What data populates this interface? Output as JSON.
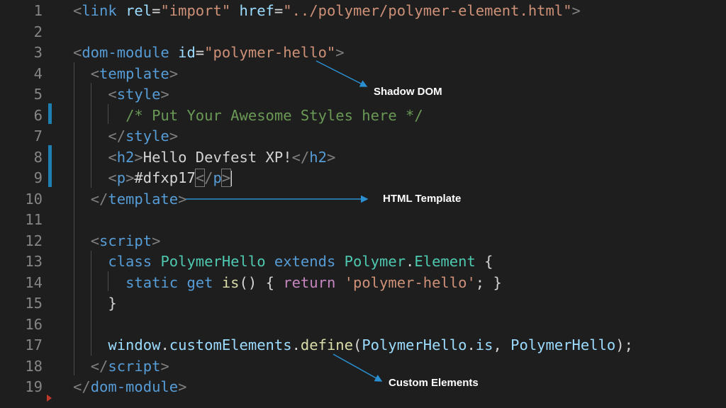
{
  "editor": {
    "line_numbers": [
      "1",
      "2",
      "3",
      "4",
      "5",
      "6",
      "7",
      "8",
      "9",
      "10",
      "11",
      "12",
      "13",
      "14",
      "15",
      "16",
      "17",
      "18",
      "19"
    ],
    "lines": [
      [
        [
          "t-punc",
          "<"
        ],
        [
          "t-tag",
          "link"
        ],
        [
          "t-plain",
          " "
        ],
        [
          "t-attr",
          "rel"
        ],
        [
          "t-plain",
          "="
        ],
        [
          "t-str",
          "\"import\""
        ],
        [
          "t-plain",
          " "
        ],
        [
          "t-attr",
          "href"
        ],
        [
          "t-plain",
          "="
        ],
        [
          "t-str",
          "\"../polymer/polymer-element.html\""
        ],
        [
          "t-punc",
          ">"
        ]
      ],
      [],
      [
        [
          "t-punc",
          "<"
        ],
        [
          "t-tag",
          "dom-module"
        ],
        [
          "t-plain",
          " "
        ],
        [
          "t-attr",
          "id"
        ],
        [
          "t-plain",
          "="
        ],
        [
          "t-str",
          "\"polymer-hello\""
        ],
        [
          "t-punc",
          ">"
        ]
      ],
      [
        [
          "t-plain",
          "  "
        ],
        [
          "t-punc",
          "<"
        ],
        [
          "t-tag",
          "template"
        ],
        [
          "t-punc",
          ">"
        ]
      ],
      [
        [
          "t-plain",
          "    "
        ],
        [
          "t-punc",
          "<"
        ],
        [
          "t-tag",
          "style"
        ],
        [
          "t-punc",
          ">"
        ]
      ],
      [
        [
          "t-plain",
          "      "
        ],
        [
          "t-comment",
          "/* Put Your Awesome Styles here */"
        ]
      ],
      [
        [
          "t-plain",
          "    "
        ],
        [
          "t-punc",
          "</"
        ],
        [
          "t-tag",
          "style"
        ],
        [
          "t-punc",
          ">"
        ]
      ],
      [
        [
          "t-plain",
          "    "
        ],
        [
          "t-punc",
          "<"
        ],
        [
          "t-tag",
          "h2"
        ],
        [
          "t-punc",
          ">"
        ],
        [
          "t-plain",
          "Hello Devfest XP!"
        ],
        [
          "t-punc",
          "</"
        ],
        [
          "t-tag",
          "h2"
        ],
        [
          "t-punc",
          ">"
        ]
      ],
      [
        [
          "t-plain",
          "    "
        ],
        [
          "t-punc",
          "<"
        ],
        [
          "t-tag",
          "p"
        ],
        [
          "t-punc",
          ">"
        ],
        [
          "t-plain",
          "#dfxp17"
        ],
        [
          "t-hl t-punc",
          "<"
        ],
        [
          "t-punc",
          "/"
        ],
        [
          "t-tag",
          "p"
        ],
        [
          "t-hl t-punc",
          ">"
        ],
        [
          "t-cursor",
          ""
        ]
      ],
      [
        [
          "t-plain",
          "  "
        ],
        [
          "t-punc",
          "</"
        ],
        [
          "t-tag",
          "template"
        ],
        [
          "t-punc",
          ">"
        ]
      ],
      [],
      [
        [
          "t-plain",
          "  "
        ],
        [
          "t-punc",
          "<"
        ],
        [
          "t-tag",
          "script"
        ],
        [
          "t-punc",
          ">"
        ]
      ],
      [
        [
          "t-plain",
          "    "
        ],
        [
          "t-kw",
          "class"
        ],
        [
          "t-plain",
          " "
        ],
        [
          "t-class",
          "PolymerHello"
        ],
        [
          "t-plain",
          " "
        ],
        [
          "t-kw",
          "extends"
        ],
        [
          "t-plain",
          " "
        ],
        [
          "t-class",
          "Polymer"
        ],
        [
          "t-plain",
          "."
        ],
        [
          "t-class",
          "Element"
        ],
        [
          "t-plain",
          " "
        ],
        [
          "t-brace",
          "{"
        ]
      ],
      [
        [
          "t-plain",
          "      "
        ],
        [
          "t-kw",
          "static"
        ],
        [
          "t-plain",
          " "
        ],
        [
          "t-kw",
          "get"
        ],
        [
          "t-plain",
          " "
        ],
        [
          "t-fn",
          "is"
        ],
        [
          "t-plain",
          "() "
        ],
        [
          "t-brace",
          "{"
        ],
        [
          "t-plain",
          " "
        ],
        [
          "t-ctrl",
          "return"
        ],
        [
          "t-plain",
          " "
        ],
        [
          "t-str",
          "'polymer-hello'"
        ],
        [
          "t-plain",
          "; "
        ],
        [
          "t-brace",
          "}"
        ]
      ],
      [
        [
          "t-plain",
          "    "
        ],
        [
          "t-brace",
          "}"
        ]
      ],
      [],
      [
        [
          "t-plain",
          "    "
        ],
        [
          "t-var",
          "window"
        ],
        [
          "t-plain",
          "."
        ],
        [
          "t-var",
          "customElements"
        ],
        [
          "t-plain",
          "."
        ],
        [
          "t-fn",
          "define"
        ],
        [
          "t-plain",
          "("
        ],
        [
          "t-var",
          "PolymerHello"
        ],
        [
          "t-plain",
          "."
        ],
        [
          "t-var",
          "is"
        ],
        [
          "t-plain",
          ", "
        ],
        [
          "t-var",
          "PolymerHello"
        ],
        [
          "t-plain",
          ");"
        ]
      ],
      [
        [
          "t-plain",
          "  "
        ],
        [
          "t-punc",
          "</"
        ],
        [
          "t-tag",
          "script"
        ],
        [
          "t-punc",
          ">"
        ]
      ],
      [
        [
          "t-punc",
          "</"
        ],
        [
          "t-tag",
          "dom-module"
        ],
        [
          "t-punc",
          ">"
        ]
      ]
    ]
  },
  "annotations": {
    "shadow_dom": "Shadow DOM",
    "html_template": "HTML Template",
    "custom_elements": "Custom Elements"
  },
  "colors": {
    "background": "#1e1e1e",
    "gutter_marker": "#1f7fb0",
    "arrow": "#2a8fd0"
  }
}
